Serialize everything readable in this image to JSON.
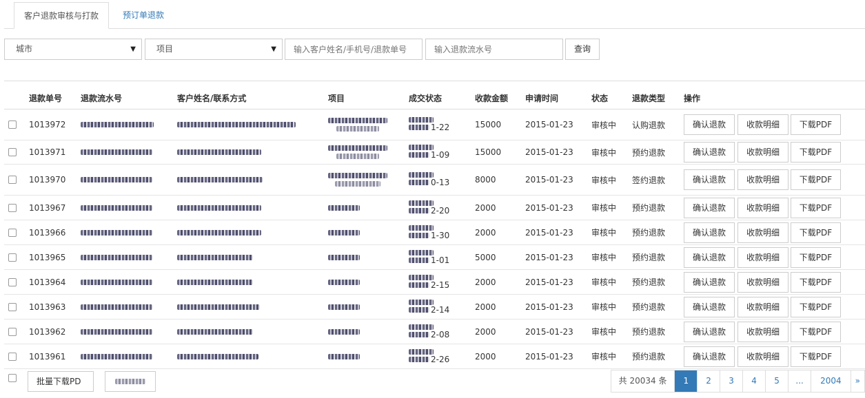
{
  "tabs": [
    {
      "label": "客户退款审核与打款",
      "active": true
    },
    {
      "label": "预订单退款",
      "active": false
    }
  ],
  "filters": {
    "city": "城市",
    "project": "项目",
    "customer_placeholder": "输入客户姓名/手机号/退款单号",
    "serial_placeholder": "输入退款流水号",
    "query_label": "查询"
  },
  "table": {
    "headers": [
      "退款单号",
      "退款流水号",
      "客户姓名/联系方式",
      "项目",
      "成交状态",
      "收款金额",
      "申请时间",
      "状态",
      "退款类型",
      "操作"
    ],
    "rows": [
      {
        "id": "1013972",
        "date_tail": "1-22",
        "amount": "15000",
        "applied": "2015-01-23",
        "status": "审核中",
        "type": "认购退款"
      },
      {
        "id": "1013971",
        "date_tail": "1-09",
        "amount": "15000",
        "applied": "2015-01-23",
        "status": "审核中",
        "type": "预约退款"
      },
      {
        "id": "1013970",
        "date_tail": "0-13",
        "amount": "8000",
        "applied": "2015-01-23",
        "status": "审核中",
        "type": "签约退款"
      },
      {
        "id": "1013967",
        "date_tail": "2-20",
        "amount": "2000",
        "applied": "2015-01-23",
        "status": "审核中",
        "type": "预约退款"
      },
      {
        "id": "1013966",
        "date_tail": "1-30",
        "amount": "2000",
        "applied": "2015-01-23",
        "status": "审核中",
        "type": "预约退款"
      },
      {
        "id": "1013965",
        "date_tail": "1-01",
        "amount": "5000",
        "applied": "2015-01-23",
        "status": "审核中",
        "type": "预约退款"
      },
      {
        "id": "1013964",
        "date_tail": "2-15",
        "amount": "2000",
        "applied": "2015-01-23",
        "status": "审核中",
        "type": "预约退款"
      },
      {
        "id": "1013963",
        "date_tail": "2-14",
        "amount": "2000",
        "applied": "2015-01-23",
        "status": "审核中",
        "type": "预约退款"
      },
      {
        "id": "1013962",
        "date_tail": "2-08",
        "amount": "2000",
        "applied": "2015-01-23",
        "status": "审核中",
        "type": "预约退款"
      },
      {
        "id": "1013961",
        "date_tail": "2-26",
        "amount": "2000",
        "applied": "2015-01-23",
        "status": "审核中",
        "type": "预约退款"
      }
    ],
    "actions": {
      "confirm": "确认退款",
      "detail": "收款明细",
      "pdf": "下载PDF"
    }
  },
  "footer": {
    "batch_download": "批量下载PD",
    "total": "共 20034 条",
    "pages": [
      "1",
      "2",
      "3",
      "4",
      "5",
      "...",
      "2004"
    ],
    "next": "»"
  },
  "colors": {
    "accent": "#337ab7",
    "border": "#dddddd"
  }
}
